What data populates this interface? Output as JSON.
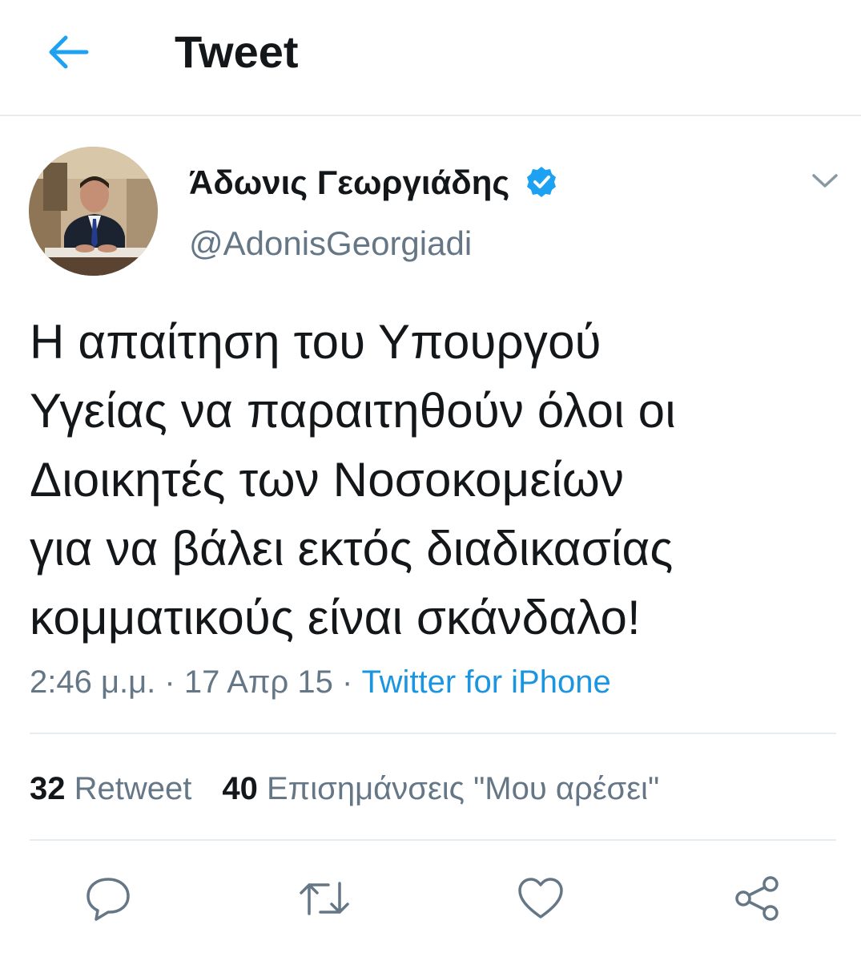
{
  "header": {
    "back_icon": "arrow-left-icon",
    "title": "Tweet"
  },
  "author": {
    "display_name": "Άδωνις Γεωργιάδης",
    "handle": "@AdonisGeorgiadi",
    "verified": true
  },
  "tweet": {
    "text": "Η απαίτηση του Υπουργού\nΥγείας να παραιτηθούν όλοι οι\nΔιοικητές των Νοσοκομείων\nγια να βάλει εκτός διαδικασίας\nκομματικούς είναι σκάνδαλο!",
    "time": "2:46 μ.μ.",
    "separator": " · ",
    "date": "17 Απρ 15",
    "source": "Twitter for iPhone"
  },
  "stats": {
    "retweets_count": "32",
    "retweets_label": "Retweet",
    "likes_count": "40",
    "likes_label": "Επισημάνσεις \"Μου αρέσει\""
  },
  "actions": [
    "reply-icon",
    "retweet-icon",
    "like-icon",
    "share-icon"
  ],
  "colors": {
    "accent": "#1da1f2",
    "link": "#1b95e0",
    "text": "#14171a",
    "secondary": "#657786",
    "divider": "#e6ecf0"
  }
}
